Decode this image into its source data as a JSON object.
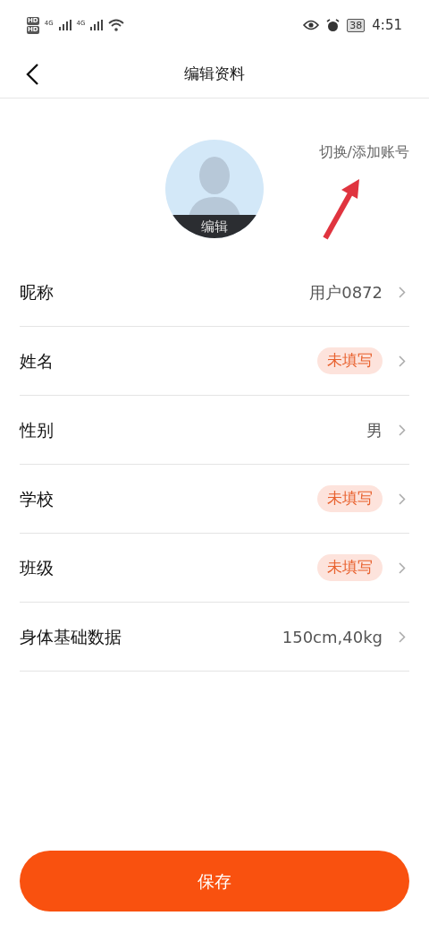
{
  "status_bar": {
    "hd": [
      "HD",
      "HD"
    ],
    "networks": [
      "4G",
      "4G"
    ],
    "battery": "38",
    "time": "4:51"
  },
  "header": {
    "title": "编辑资料"
  },
  "avatar": {
    "label": "编辑"
  },
  "switch_account": "切换/添加账号",
  "rows": [
    {
      "label": "昵称",
      "kind": "value",
      "value": "用户0872"
    },
    {
      "label": "姓名",
      "kind": "badge",
      "value": "未填写"
    },
    {
      "label": "性别",
      "kind": "value",
      "value": "男"
    },
    {
      "label": "学校",
      "kind": "badge",
      "value": "未填写"
    },
    {
      "label": "班级",
      "kind": "badge",
      "value": "未填写"
    },
    {
      "label": "身体基础数据",
      "kind": "value",
      "value": "150cm,40kg"
    }
  ],
  "save_button": "保存"
}
